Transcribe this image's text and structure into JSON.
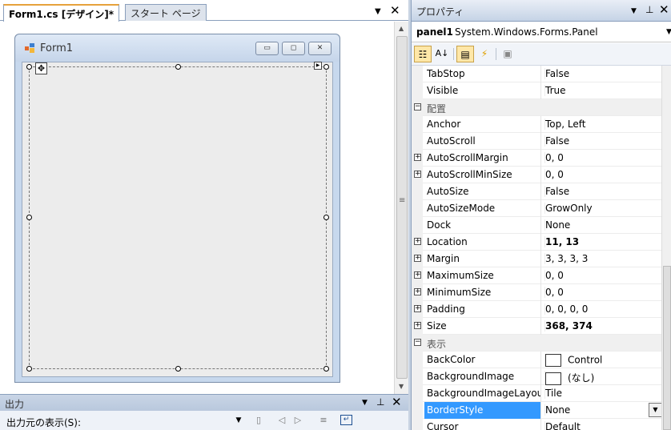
{
  "designer": {
    "tabs": [
      {
        "label": "Form1.cs [デザイン]*",
        "active": true
      },
      {
        "label": "スタート ページ",
        "active": false
      }
    ],
    "dropdown_icon": "chevron-down-icon",
    "close_icon": "close-icon",
    "form": {
      "title": "Form1",
      "minimize_glyph": "▭",
      "maximize_glyph": "◻",
      "close_glyph": "✕"
    },
    "panel_name": "panel1"
  },
  "output": {
    "title": "出力",
    "source_label": "出力元の表示(S):"
  },
  "properties": {
    "title": "プロパティ",
    "object_name": "panel1",
    "object_type": "System.Windows.Forms.Panel",
    "rows": [
      {
        "kind": "prop",
        "name": "TabStop",
        "value": "False"
      },
      {
        "kind": "prop",
        "name": "Visible",
        "value": "True"
      },
      {
        "kind": "category",
        "name": "配置",
        "expander": "⊟"
      },
      {
        "kind": "prop",
        "name": "Anchor",
        "value": "Top, Left"
      },
      {
        "kind": "prop",
        "name": "AutoScroll",
        "value": "False"
      },
      {
        "kind": "prop",
        "name": "AutoScrollMargin",
        "value": "0, 0",
        "expander": "⊞"
      },
      {
        "kind": "prop",
        "name": "AutoScrollMinSize",
        "value": "0, 0",
        "expander": "⊞"
      },
      {
        "kind": "prop",
        "name": "AutoSize",
        "value": "False"
      },
      {
        "kind": "prop",
        "name": "AutoSizeMode",
        "value": "GrowOnly"
      },
      {
        "kind": "prop",
        "name": "Dock",
        "value": "None"
      },
      {
        "kind": "prop",
        "name": "Location",
        "value": "11, 13",
        "bold": true,
        "expander": "⊞"
      },
      {
        "kind": "prop",
        "name": "Margin",
        "value": "3, 3, 3, 3",
        "expander": "⊞"
      },
      {
        "kind": "prop",
        "name": "MaximumSize",
        "value": "0, 0",
        "expander": "⊞"
      },
      {
        "kind": "prop",
        "name": "MinimumSize",
        "value": "0, 0",
        "expander": "⊞"
      },
      {
        "kind": "prop",
        "name": "Padding",
        "value": "0, 0, 0, 0",
        "expander": "⊞"
      },
      {
        "kind": "prop",
        "name": "Size",
        "value": "368, 374",
        "bold": true,
        "expander": "⊞"
      },
      {
        "kind": "category",
        "name": "表示",
        "expander": "⊟"
      },
      {
        "kind": "prop",
        "name": "BackColor",
        "value": "Control",
        "swatch": true
      },
      {
        "kind": "prop",
        "name": "BackgroundImage",
        "value": "(なし)",
        "swatch": true
      },
      {
        "kind": "prop",
        "name": "BackgroundImageLayou",
        "value": "Tile"
      },
      {
        "kind": "prop",
        "name": "BorderStyle",
        "value": "None",
        "selected": true,
        "combo": true
      },
      {
        "kind": "prop",
        "name": "Cursor",
        "value": "Default"
      }
    ]
  },
  "colors": {
    "selection": "#3399ff",
    "panel_chrome": "#c8d3e2",
    "active_tab_accent": "#e6a23c"
  }
}
